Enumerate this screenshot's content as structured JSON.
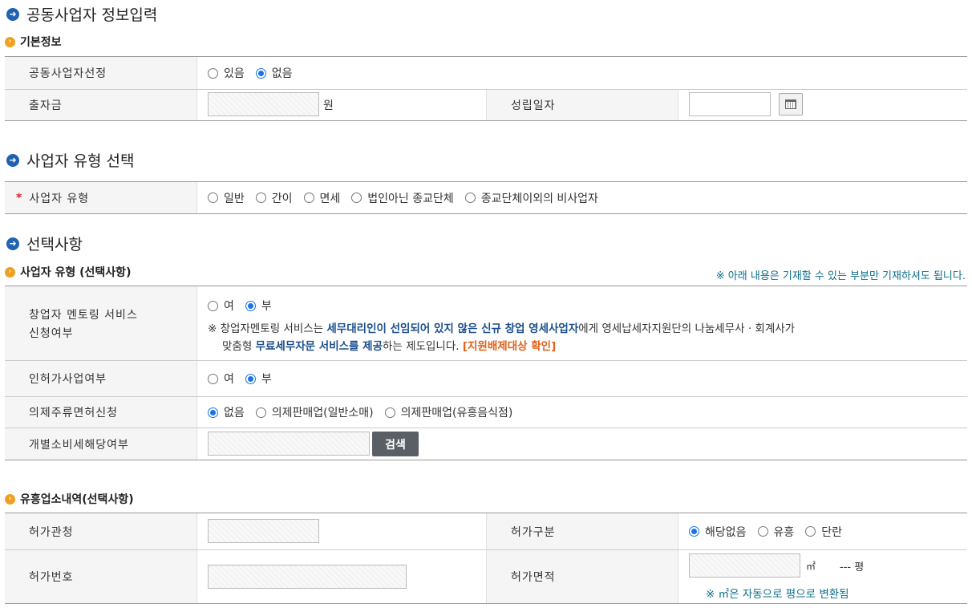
{
  "joint": {
    "title": "공동사업자 정보입력",
    "sub": "기본정보",
    "select_label": "공동사업자선정",
    "opt_yes": "있음",
    "opt_no": "없음",
    "investment_label": "출자금",
    "investment_unit": "원",
    "founded_label": "성립일자"
  },
  "biztype": {
    "title": "사업자 유형 선택",
    "label": "사업자 유형",
    "options": [
      "일반",
      "간이",
      "면세",
      "법인아닌 종교단체",
      "종교단체이외의 비사업자"
    ]
  },
  "optional": {
    "title": "선택사항",
    "sub": "사업자 유형 (선택사항)",
    "right_note": "※ 아래 내용은 기재할 수 있는 부분만 기재하셔도 됩니다.",
    "mentoring_label_1": "창업자 멘토링 서비스",
    "mentoring_label_2": "신청여부",
    "yes": "여",
    "no": "부",
    "note_a": "※ 창업자멘토링 서비스는 ",
    "note_b": "세무대리인이 선임되어 있지 않은 신규 창업 영세사업자",
    "note_c": "에게 영세납세자지원단의 나눔세무사 · 회계사가",
    "note_d": "맞춤형 ",
    "note_e": "무료세무자문 서비스를 제공",
    "note_f": "하는 제도입니다. ",
    "note_g": "[지원배제대상 확인]",
    "permit_label": "인허가사업여부",
    "liquor_label": "의제주류면허신청",
    "liquor_opts": [
      "없음",
      "의제판매업(일반소매)",
      "의제판매업(유흥음식점)"
    ],
    "excise_label": "개별소비세해당여부",
    "search_btn": "검색"
  },
  "venue": {
    "sub": "유흥업소내역(선택사항)",
    "office_label": "허가관청",
    "kind_label": "허가구분",
    "kind_opts": [
      "해당없음",
      "유흥",
      "단란"
    ],
    "number_label": "허가번호",
    "area_label": "허가면적",
    "sqm": "㎡",
    "pyeong": "--- 평",
    "area_note": "※ ㎡은 자동으로 평으로 변환됨"
  },
  "colors": {
    "accent_blue": "#1a73e8",
    "navy": "#1b4f8c",
    "orange": "#e0621a",
    "note": "#0b6e8a"
  }
}
